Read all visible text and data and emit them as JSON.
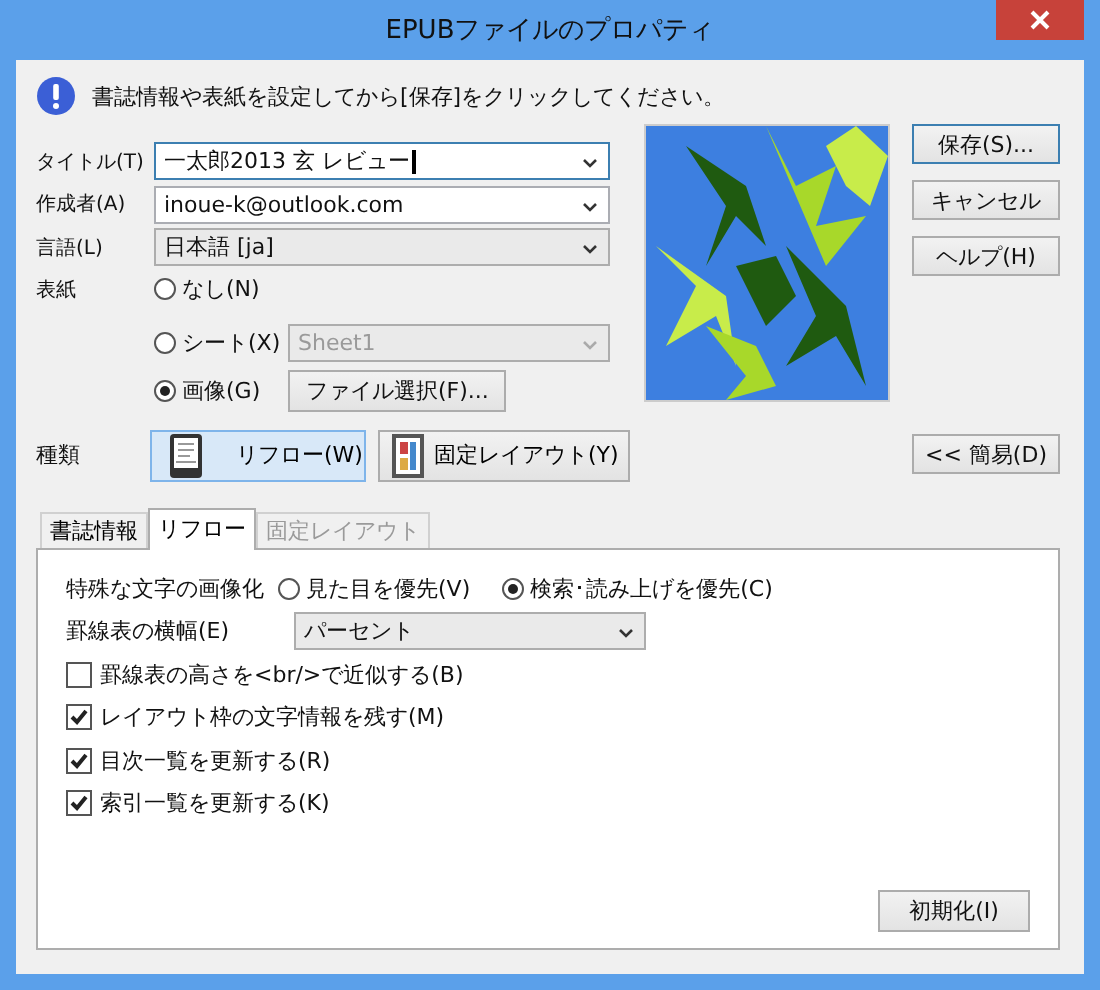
{
  "window": {
    "title": "EPUBファイルのプロパティ"
  },
  "message": "書誌情報や表紙を設定してから[保存]をクリックしてください。",
  "fields": [
    {
      "label": "タイトル(T)",
      "value": "一太郎2013 玄 レビュー",
      "kind": "combo",
      "focused": true
    },
    {
      "label": "作成者(A)",
      "value": "inoue-k@outlook.com",
      "kind": "combo",
      "focused": false
    },
    {
      "label": "言語(L)",
      "value": "日本語  [ja]",
      "kind": "dropdown",
      "focused": false
    }
  ],
  "cover": {
    "label": "表紙",
    "options": [
      {
        "label": "なし(N)",
        "selected": false
      },
      {
        "label": "シート(X)",
        "selected": false,
        "sheet": {
          "value": "Sheet1",
          "disabled": true
        }
      },
      {
        "label": "画像(G)",
        "selected": true,
        "button": "ファイル選択(F)..."
      }
    ]
  },
  "type": {
    "label": "種類",
    "options": [
      {
        "label": "リフロー(W)",
        "selected": true,
        "kind": "reflow"
      },
      {
        "label": "固定レイアウト(Y)",
        "selected": false,
        "kind": "fixed"
      }
    ]
  },
  "side_buttons": [
    {
      "label": "保存(S)...",
      "default": true
    },
    {
      "label": "キャンセル",
      "default": false
    },
    {
      "label": "ヘルプ(H)",
      "default": false
    }
  ],
  "simple_button": "<< 簡易(D)",
  "tabs": [
    {
      "label": "書誌情報",
      "selected": false,
      "disabled": false
    },
    {
      "label": "リフロー",
      "selected": true,
      "disabled": false
    },
    {
      "label": "固定レイアウト",
      "selected": false,
      "disabled": true
    }
  ],
  "panel": {
    "render": {
      "label": "特殊な文字の画像化",
      "options": [
        {
          "label": "見た目を優先(V)",
          "selected": false
        },
        {
          "label": "検索･読み上げを優先(C)",
          "selected": true
        }
      ]
    },
    "width": {
      "label": "罫線表の横幅(E)",
      "value": "パーセント"
    },
    "checkboxes": [
      {
        "label": "罫線表の高さを<br/>で近似する(B)",
        "checked": false
      },
      {
        "label": "レイアウト枠の文字情報を残す(M)",
        "checked": true
      },
      {
        "label": "目次一覧を更新する(R)",
        "checked": true
      },
      {
        "label": "索引一覧を更新する(K)",
        "checked": true
      }
    ],
    "reset_button": "初期化(I)"
  }
}
